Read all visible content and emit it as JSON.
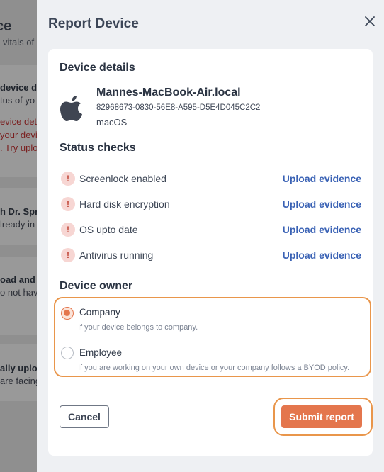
{
  "background": {
    "title": "ce",
    "subtitle": "vitals of",
    "cards": [
      {
        "title": "device de",
        "line": "tus of yo",
        "red1": "evice det",
        "red2": "your devi",
        "red3": ". Try uplo"
      },
      {
        "title": "h Dr. Spr",
        "line": "lready in"
      },
      {
        "title": "oad and",
        "line": "o not hav"
      },
      {
        "title": "ally uploa",
        "line": "are facing"
      }
    ]
  },
  "drawer": {
    "title": "Report Device",
    "close_icon": "close-icon"
  },
  "device_details": {
    "heading": "Device details",
    "icon": "apple-logo-icon",
    "name": "Mannes-MacBook-Air.local",
    "id": "82968673-0830-56E8-A595-D5E4D045C2C2",
    "os": "macOS"
  },
  "status_checks": {
    "heading": "Status checks",
    "items": [
      {
        "label": "Screenlock enabled",
        "action": "Upload evidence",
        "status_icon": "warning-icon"
      },
      {
        "label": "Hard disk encryption",
        "action": "Upload evidence",
        "status_icon": "warning-icon"
      },
      {
        "label": "OS upto date",
        "action": "Upload evidence",
        "status_icon": "warning-icon"
      },
      {
        "label": "Antivirus running",
        "action": "Upload evidence",
        "status_icon": "warning-icon"
      }
    ]
  },
  "device_owner": {
    "heading": "Device owner",
    "options": [
      {
        "label": "Company",
        "help": "If your device belongs to company.",
        "selected": true
      },
      {
        "label": "Employee",
        "help": "If you are working on your own device or your company follows a BYOD policy.",
        "selected": false
      }
    ]
  },
  "actions": {
    "cancel_label": "Cancel",
    "submit_label": "Submit report"
  },
  "colors": {
    "accent": "#e4764d",
    "highlight": "#e9964b",
    "link": "#3a62b5",
    "warning_bg": "#f7d6d3",
    "warning_fg": "#c2493b"
  }
}
